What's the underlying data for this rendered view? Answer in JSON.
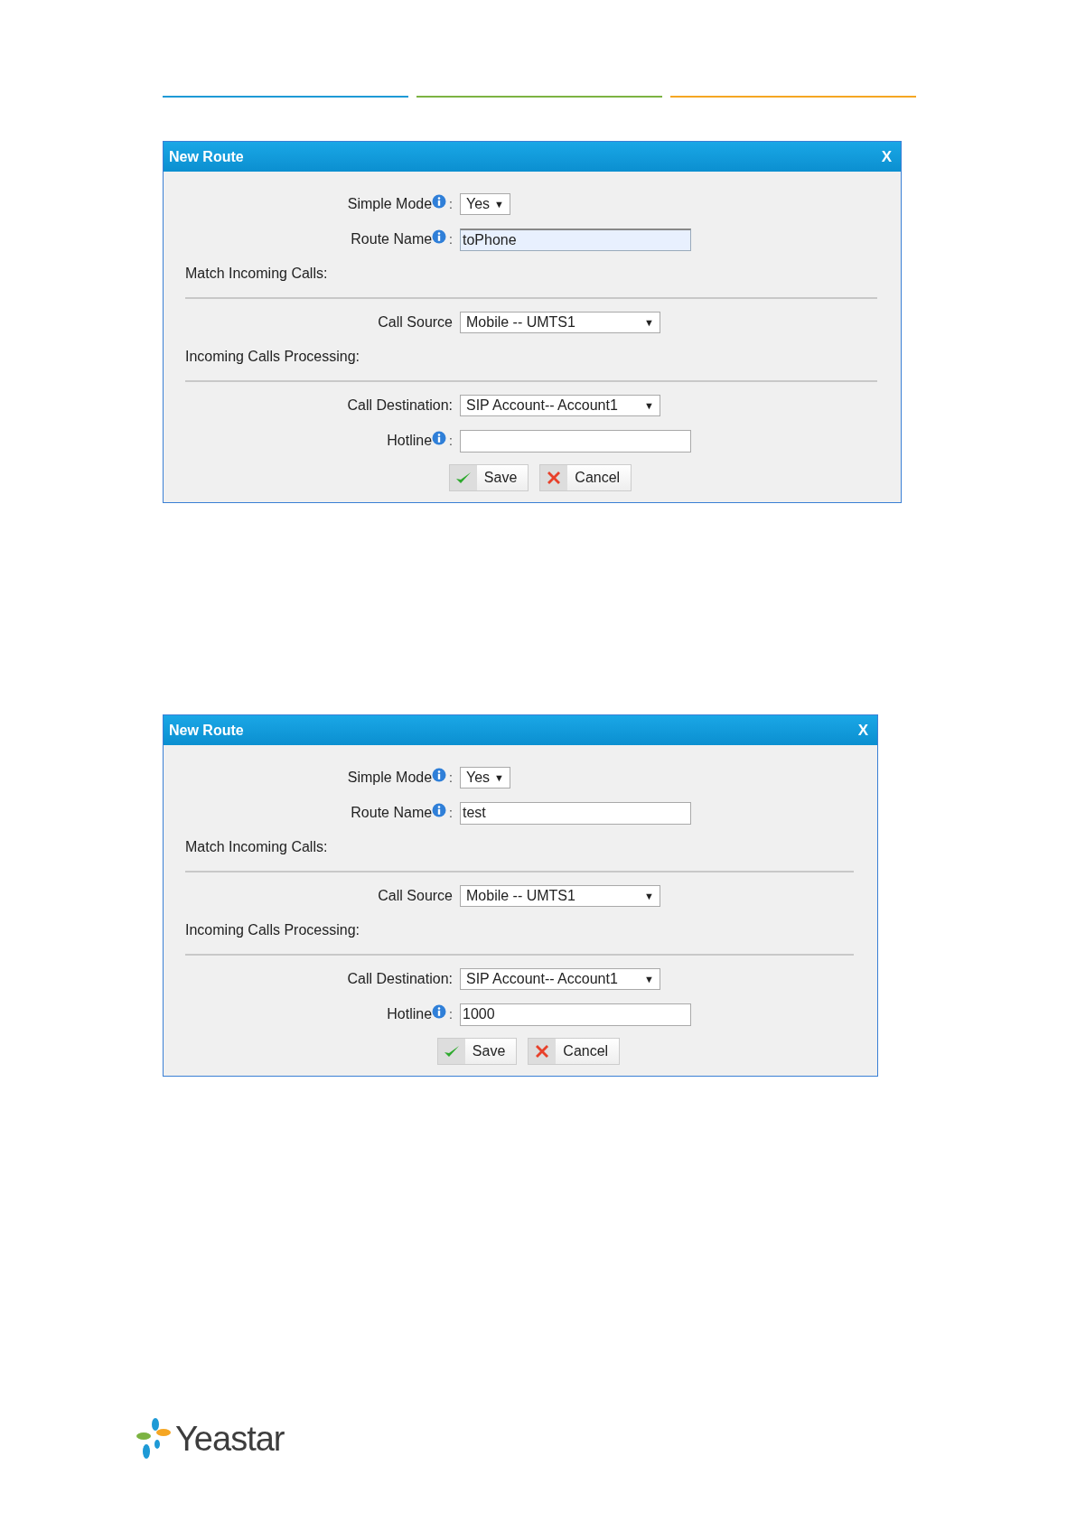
{
  "header_rules": [
    {
      "color": "#1e9ad6"
    },
    {
      "color": "#7cb342"
    },
    {
      "color": "#f5a623"
    }
  ],
  "dialogs": [
    {
      "title": "New Route",
      "close": "X",
      "rows": [
        {
          "kind": "select",
          "label": "Simple Mode",
          "info": true,
          "colon": ":",
          "value": "Yes",
          "caret": "▼"
        },
        {
          "kind": "input",
          "label": "Route Name",
          "info": true,
          "colon": ":",
          "value": "toPhone",
          "focused": true
        },
        {
          "kind": "section",
          "label": "Match Incoming Calls:"
        },
        {
          "kind": "select",
          "label": "Call Source",
          "info": false,
          "value": "Mobile -- UMTS1",
          "caret": "▼"
        },
        {
          "kind": "section",
          "label": "Incoming Calls Processing:"
        },
        {
          "kind": "select",
          "label": "Call Destination:",
          "info": false,
          "value": "SIP Account-- Account1",
          "caret": "▼"
        },
        {
          "kind": "input",
          "label": "Hotline",
          "info": true,
          "colon": ":",
          "value": "",
          "focused": false
        }
      ],
      "buttons": [
        {
          "kind": "save",
          "label": "Save"
        },
        {
          "kind": "cancel",
          "label": "Cancel"
        }
      ]
    },
    {
      "title": "New Route",
      "close": "X",
      "rows": [
        {
          "kind": "select",
          "label": "Simple Mode",
          "info": true,
          "colon": ":",
          "value": "Yes",
          "caret": "▼"
        },
        {
          "kind": "input",
          "label": "Route Name",
          "info": true,
          "colon": ":",
          "value": "test",
          "focused": false
        },
        {
          "kind": "section",
          "label": "Match Incoming Calls:"
        },
        {
          "kind": "select",
          "label": "Call Source",
          "info": false,
          "value": "Mobile -- UMTS1",
          "caret": "▼"
        },
        {
          "kind": "section",
          "label": "Incoming Calls Processing:"
        },
        {
          "kind": "select",
          "label": "Call Destination:",
          "info": false,
          "value": "SIP Account-- Account1",
          "caret": "▼"
        },
        {
          "kind": "input",
          "label": "Hotline",
          "info": true,
          "colon": ":",
          "value": "1000",
          "focused": false
        }
      ],
      "buttons": [
        {
          "kind": "save",
          "label": "Save"
        },
        {
          "kind": "cancel",
          "label": "Cancel"
        }
      ]
    }
  ],
  "logo": {
    "text": "Yeastar"
  }
}
